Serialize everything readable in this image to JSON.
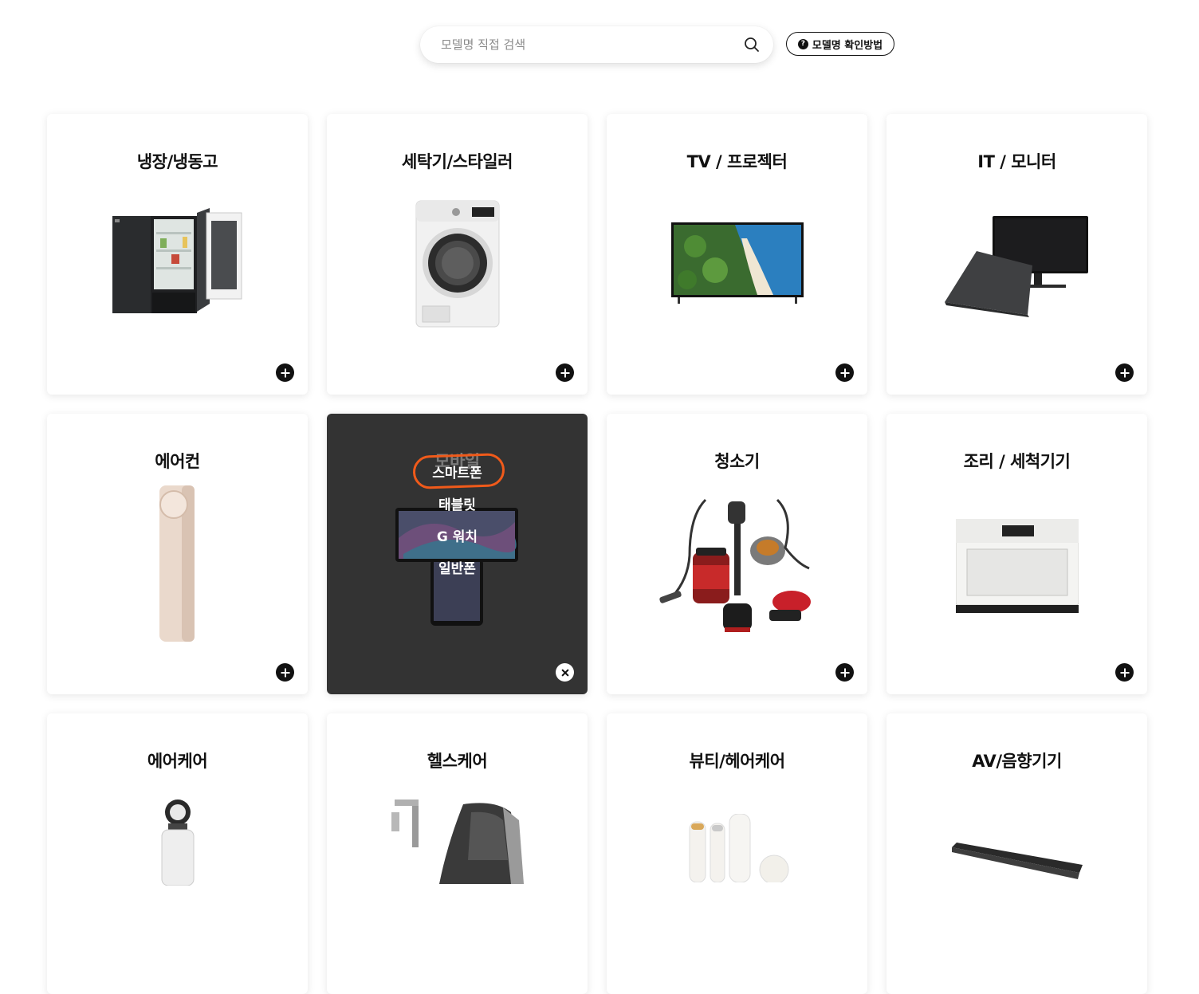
{
  "search": {
    "placeholder": "모델명 직접 검색",
    "value": ""
  },
  "help_button": {
    "label": "모델명 확인방법",
    "icon_glyph": "?"
  },
  "categories": [
    {
      "label": "냉장/냉동고",
      "icon": "refrigerator-image"
    },
    {
      "label": "세탁기/스타일러",
      "icon": "washing-machine-image"
    },
    {
      "label": "TV / 프로젝터",
      "icon": "tv-image"
    },
    {
      "label": "IT / 모니터",
      "icon": "monitor-laptop-image"
    },
    {
      "label": "에어컨",
      "icon": "air-conditioner-image"
    },
    {
      "label": "모바일",
      "icon": "mobile-image",
      "expanded": true,
      "submenu": [
        "스마트폰",
        "태블릿",
        "G 워치",
        "일반폰"
      ]
    },
    {
      "label": "청소기",
      "icon": "vacuum-image"
    },
    {
      "label": "조리 / 세척기기",
      "icon": "oven-image"
    },
    {
      "label": "에어케어",
      "icon": "air-purifier-image"
    },
    {
      "label": "헬스케어",
      "icon": "massage-chair-image"
    },
    {
      "label": "뷰티/헤어케어",
      "icon": "beauty-device-image"
    },
    {
      "label": "AV/음향기기",
      "icon": "soundbar-image"
    }
  ],
  "colors": {
    "active_card": "#333333",
    "highlight": "#f05a1a"
  }
}
